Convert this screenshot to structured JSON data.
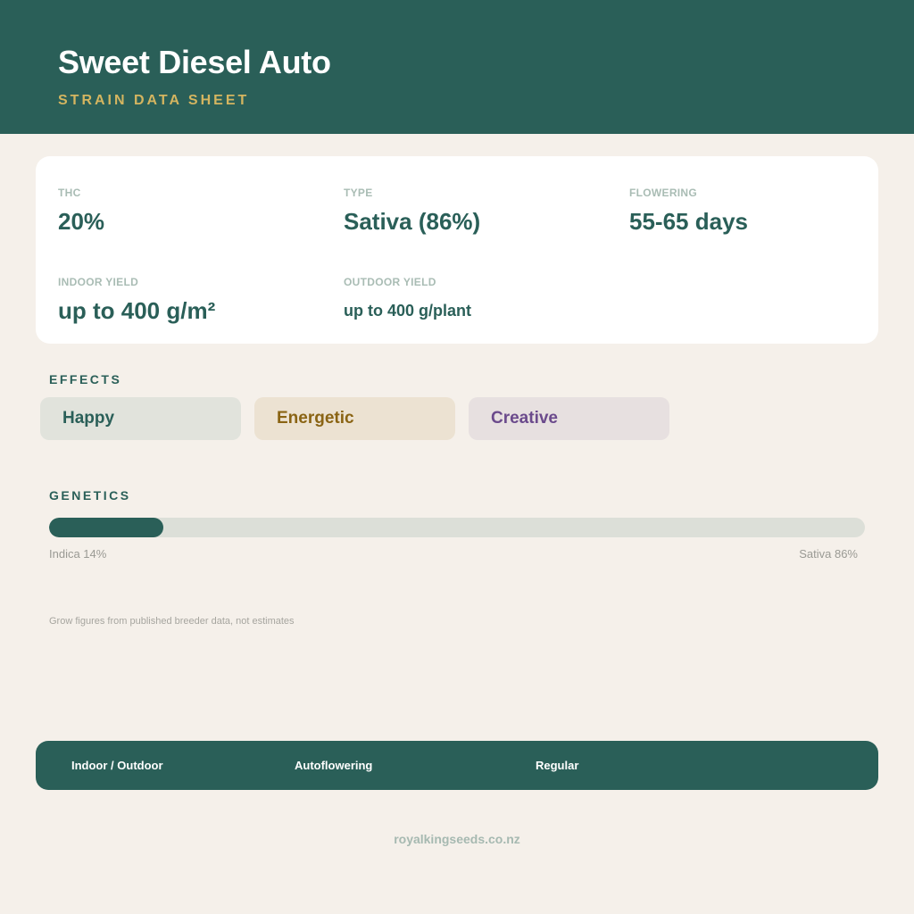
{
  "header": {
    "title": "Sweet Diesel Auto",
    "subtitle": "STRAIN DATA SHEET"
  },
  "stats": {
    "thc": {
      "label": "THC",
      "value": "20%"
    },
    "type": {
      "label": "TYPE",
      "value": "Sativa (86%)"
    },
    "flowering": {
      "label": "FLOWERING",
      "value": "55-65 days"
    },
    "indoor_yield": {
      "label": "INDOOR YIELD",
      "value": "up to 400 g/m²"
    },
    "outdoor_yield": {
      "label": "OUTDOOR YIELD",
      "value": "up to 400 g/plant"
    }
  },
  "effects": {
    "label": "EFFECTS",
    "items": [
      {
        "label": "Happy",
        "bg": "#e1e3dc",
        "color": "#2a5f58"
      },
      {
        "label": "Energetic",
        "bg": "#ece2d2",
        "color": "#8a6414"
      },
      {
        "label": "Creative",
        "bg": "#e7e0e0",
        "color": "#6b4a8c"
      }
    ]
  },
  "genetics": {
    "label": "GENETICS",
    "indica_percent": 14,
    "sativa_percent": 86,
    "indica_caption": "Indica 14%",
    "sativa_caption": "Sativa 86%"
  },
  "note": "Grow figures from published breeder data, not estimates",
  "footer": {
    "items": [
      "Indoor / Outdoor",
      "Autoflowering",
      "Regular"
    ]
  },
  "site": "royalkingseeds.co.nz",
  "colors": {
    "primary": "#2a5f58",
    "accent": "#d4b560",
    "background": "#f5f0ea"
  }
}
